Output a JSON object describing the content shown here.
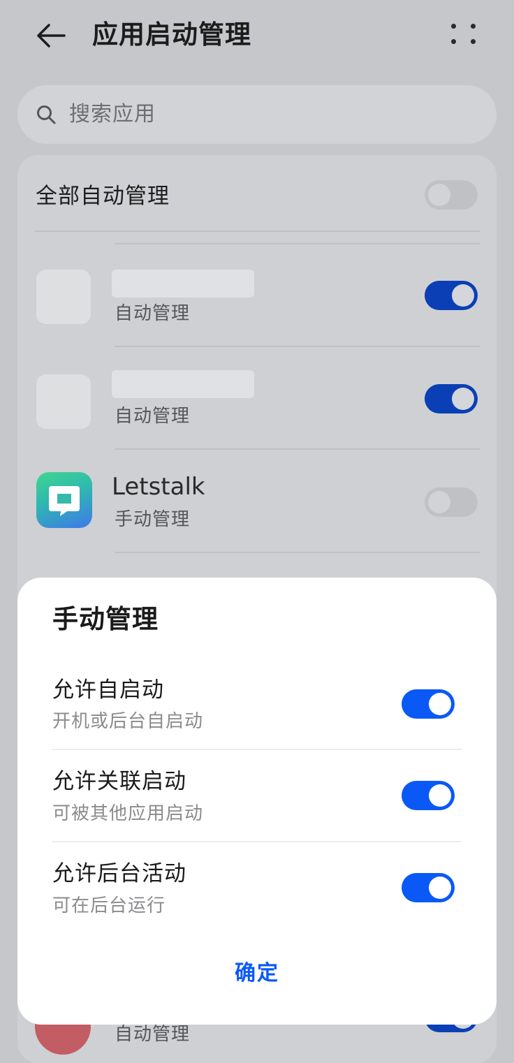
{
  "header": {
    "title": "应用启动管理"
  },
  "search": {
    "placeholder": "搜索应用"
  },
  "all_auto": {
    "label": "全部自动管理",
    "enabled": false
  },
  "apps": [
    {
      "name": "",
      "status": "自动管理",
      "enabled": true,
      "icon": "blank-app-icon"
    },
    {
      "name": "",
      "status": "自动管理",
      "enabled": true,
      "icon": "blank-app-icon"
    },
    {
      "name": "Letstalk",
      "status": "手动管理",
      "enabled": false,
      "icon": "letstalk-app-icon"
    },
    {
      "name": "",
      "status": "自动管理",
      "enabled": true,
      "icon": "red-app-icon"
    }
  ],
  "sheet": {
    "title": "手动管理",
    "options": [
      {
        "title": "允许自启动",
        "subtitle": "开机或后台自启动",
        "enabled": true
      },
      {
        "title": "允许关联启动",
        "subtitle": "可被其他应用启动",
        "enabled": true
      },
      {
        "title": "允许后台活动",
        "subtitle": "可在后台运行",
        "enabled": true
      }
    ],
    "confirm_label": "确定"
  },
  "colors": {
    "accent": "#0a59f7",
    "scrim_bg": "#c6c7ca",
    "sheet_bg": "#ffffff"
  }
}
